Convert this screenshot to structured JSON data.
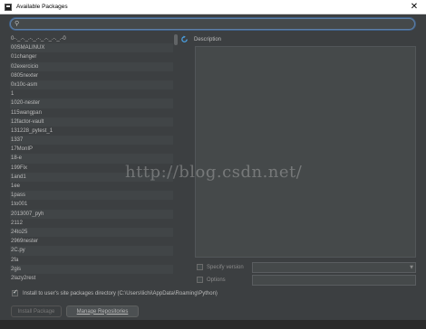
{
  "window": {
    "title": "Available Packages"
  },
  "search": {
    "value": "",
    "placeholder": ""
  },
  "packages": [
    "0-._.-._.-._.-._.-._.-._.-0",
    "00SMALINUX",
    "01changer",
    "02exercicio",
    "0805nexter",
    "0x10c-asm",
    "1",
    "1020-nester",
    "115wangpan",
    "12factor-vault",
    "131228_pytest_1",
    "1337",
    "17MonIP",
    "18-e",
    "199Fix",
    "1and1",
    "1ee",
    "1pass",
    "1to001",
    "2013007_pyh",
    "2112",
    "24to25",
    "2969nester",
    "2C.py",
    "2fa",
    "2gis",
    "2lazy2rest"
  ],
  "description": {
    "label": "Description",
    "text": ""
  },
  "options": {
    "specify_version_label": "Specify version",
    "specify_version_checked": false,
    "options_label": "Options",
    "options_checked": false,
    "options_value": ""
  },
  "install_to_user": {
    "label": "Install to user's site packages directory (C:\\Users\\lichi\\AppData\\Roaming\\Python)",
    "checked": true
  },
  "buttons": {
    "install": "Install Package",
    "manage": "Manage Repositories"
  },
  "watermark": "http://blog.csdn.net/",
  "colors": {
    "background": "#3c3f41",
    "focus_ring": "#5e7fa6",
    "text": "#bbbbbb"
  }
}
